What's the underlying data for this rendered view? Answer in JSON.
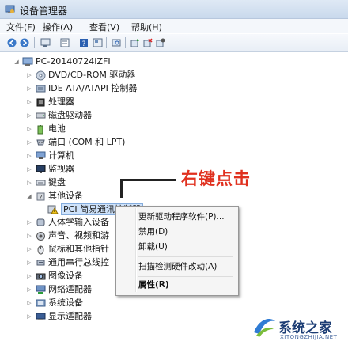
{
  "window": {
    "title": "设备管理器"
  },
  "menubar": [
    "文件(F)",
    "操作(A)",
    "查看(V)",
    "帮助(H)"
  ],
  "toolbar": [
    "back-icon",
    "forward-icon",
    "sep",
    "computer-view-icon",
    "sep",
    "properties-icon",
    "sep",
    "help-icon",
    "device-view-icon",
    "sep",
    "scan-icon",
    "sep",
    "update-driver-icon",
    "uninstall-icon",
    "disable-icon"
  ],
  "tree": {
    "root": "PC-20140724IZFI",
    "children": [
      {
        "label": "DVD/CD-ROM 驱动器",
        "icon": "dvd-icon"
      },
      {
        "label": "IDE ATA/ATAPI 控制器",
        "icon": "ide-icon"
      },
      {
        "label": "处理器",
        "icon": "processor-icon"
      },
      {
        "label": "磁盘驱动器",
        "icon": "disk-icon"
      },
      {
        "label": "电池",
        "icon": "battery-icon"
      },
      {
        "label": "端口 (COM 和 LPT)",
        "icon": "port-icon"
      },
      {
        "label": "计算机",
        "icon": "computer-icon"
      },
      {
        "label": "监视器",
        "icon": "monitor-icon"
      },
      {
        "label": "键盘",
        "icon": "keyboard-icon"
      },
      {
        "label": "其他设备",
        "icon": "other-devices-icon",
        "expanded": true
      },
      {
        "label": "PCI 简易通讯控制器",
        "icon": "warning-device-icon",
        "child": true,
        "selected": true
      },
      {
        "label": "人体学输入设备",
        "icon": "hid-icon"
      },
      {
        "label": "声音、视频和游",
        "icon": "sound-icon"
      },
      {
        "label": "鼠标和其他指针",
        "icon": "mouse-icon"
      },
      {
        "label": "通用串行总线控",
        "icon": "usb-icon"
      },
      {
        "label": "图像设备",
        "icon": "imaging-icon"
      },
      {
        "label": "网络适配器",
        "icon": "network-icon"
      },
      {
        "label": "系统设备",
        "icon": "system-icon"
      },
      {
        "label": "显示适配器",
        "icon": "display-icon"
      }
    ]
  },
  "annotation": {
    "text": "右键点击"
  },
  "context_menu": {
    "items": [
      {
        "label": "更新驱动程序软件(P)...",
        "bold": false
      },
      {
        "label": "禁用(D)",
        "bold": false
      },
      {
        "label": "卸载(U)",
        "bold": false
      },
      {
        "label": "扫描检测硬件改动(A)",
        "bold": false
      },
      {
        "label": "属性(R)",
        "bold": true
      }
    ]
  },
  "watermark": {
    "text": "系统之家",
    "sub": "XITONGZHIJIA.NET"
  },
  "colors": {
    "annotation": "#e0301e",
    "selection": "#cfe3fb",
    "watermark": "#1b3c74"
  }
}
